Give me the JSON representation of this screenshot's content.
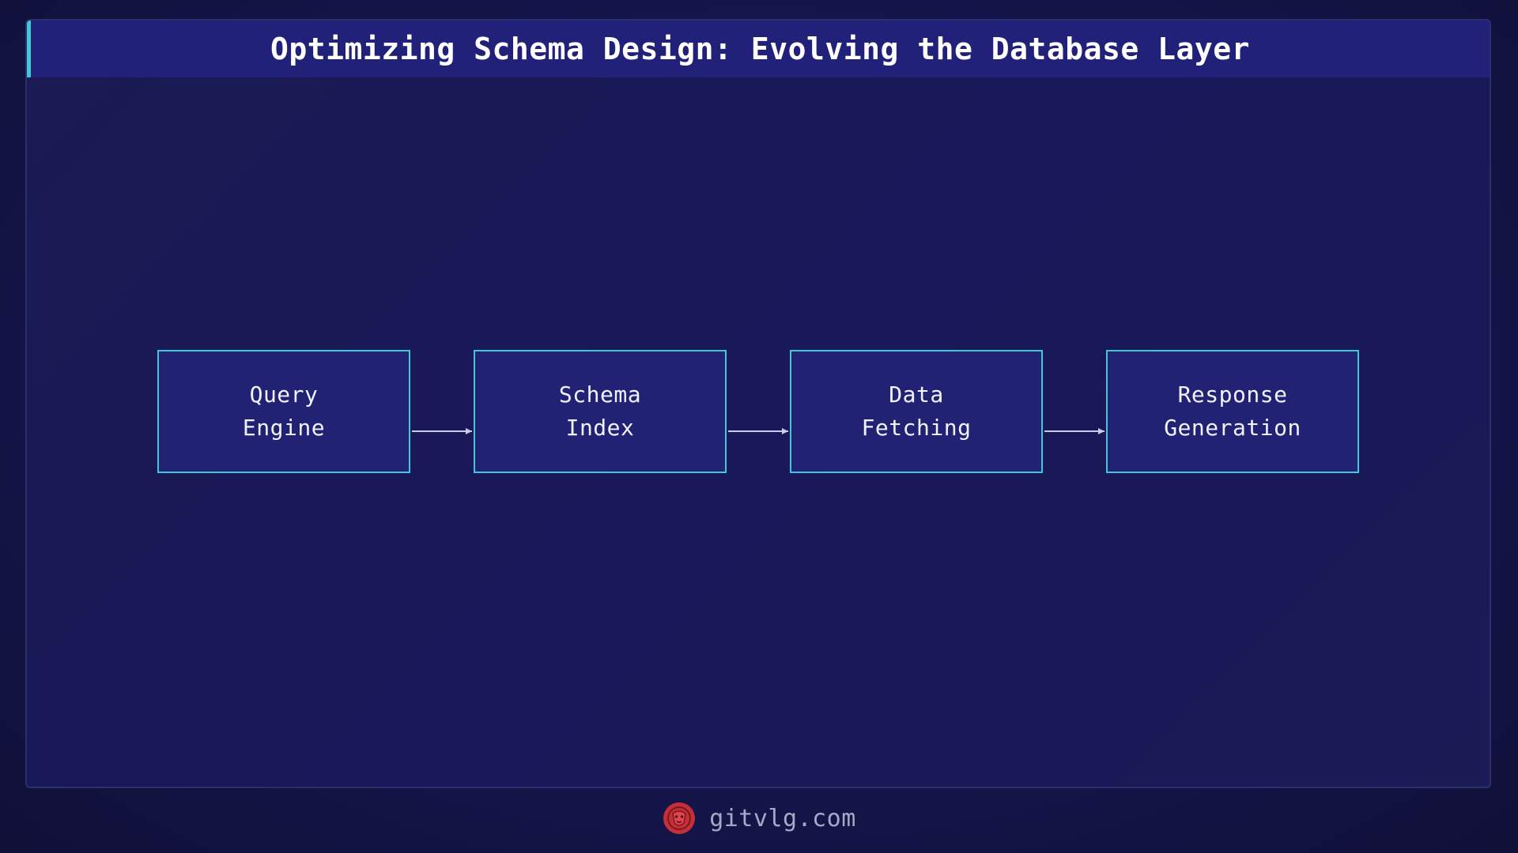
{
  "title": "Optimizing Schema Design: Evolving the Database Layer",
  "diagram": {
    "nodes": [
      {
        "label": "Query\nEngine"
      },
      {
        "label": "Schema\nIndex"
      },
      {
        "label": "Data\nFetching"
      },
      {
        "label": "Response\nGeneration"
      }
    ]
  },
  "footer": {
    "site": "gitvlg.com",
    "logo_icon": "lion-head-icon"
  },
  "colors": {
    "accent": "#3ec9d6",
    "title_bar": "#22217a",
    "node_fill": "#222275",
    "logo": "#d0313a"
  }
}
